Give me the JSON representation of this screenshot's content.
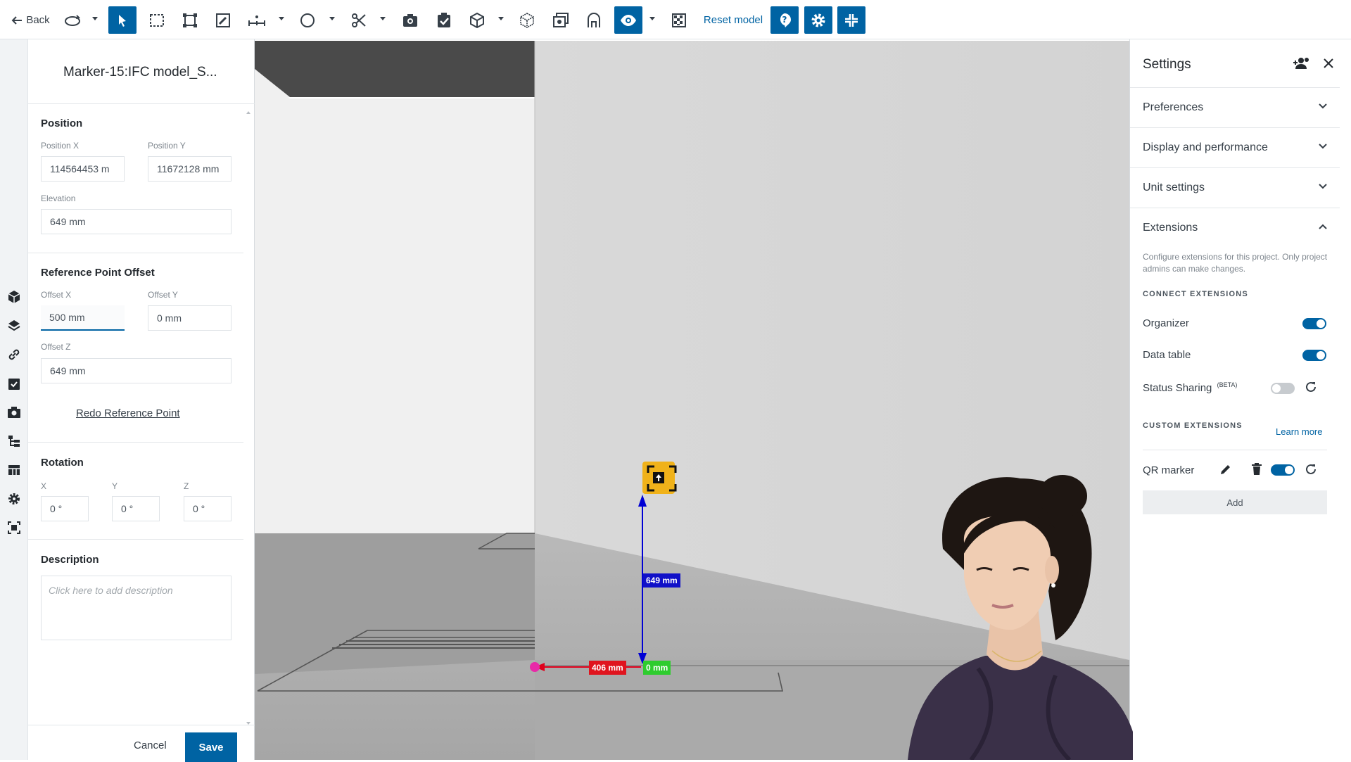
{
  "toolbar": {
    "back_label": "Back",
    "reset_label": "Reset model",
    "accent": "#0063a3"
  },
  "marker_panel": {
    "title": "Marker-15:IFC model_S...",
    "position": {
      "section": "Position",
      "x_label": "Position X",
      "x_value": "114564453 m",
      "y_label": "Position Y",
      "y_value": "11672128 mm",
      "elev_label": "Elevation",
      "elev_value": "649 mm"
    },
    "offset": {
      "section": "Reference Point Offset",
      "x_label": "Offset X",
      "x_value": "500 mm",
      "y_label": "Offset Y",
      "y_value": "0 mm",
      "z_label": "Offset Z",
      "z_value": "649 mm",
      "redo_label": "Redo Reference Point"
    },
    "rotation": {
      "section": "Rotation",
      "x_label": "X",
      "x_value": "0 °",
      "y_label": "Y",
      "y_value": "0 °",
      "z_label": "Z",
      "z_value": "0 °"
    },
    "description": {
      "section": "Description",
      "placeholder": "Click here to add description"
    },
    "cancel_label": "Cancel",
    "save_label": "Save"
  },
  "viewport": {
    "dim_x": "406 mm",
    "dim_z": "649 mm",
    "dim_y": "0 mm"
  },
  "settings": {
    "title": "Settings",
    "sections": {
      "preferences": "Preferences",
      "display": "Display and performance",
      "units": "Unit settings",
      "extensions": "Extensions"
    },
    "extensions_desc": "Configure extensions for this project. Only project admins can make changes.",
    "connect_head": "CONNECT EXTENSIONS",
    "organizer": "Organizer",
    "data_table": "Data table",
    "status_sharing": "Status Sharing",
    "beta": "(BETA)",
    "custom_head": "CUSTOM EXTENSIONS",
    "learn_more": "Learn more",
    "qr_marker": "QR marker",
    "add_label": "Add",
    "toggles": {
      "organizer": true,
      "data_table": true,
      "status_sharing": false,
      "qr_marker": true
    }
  }
}
